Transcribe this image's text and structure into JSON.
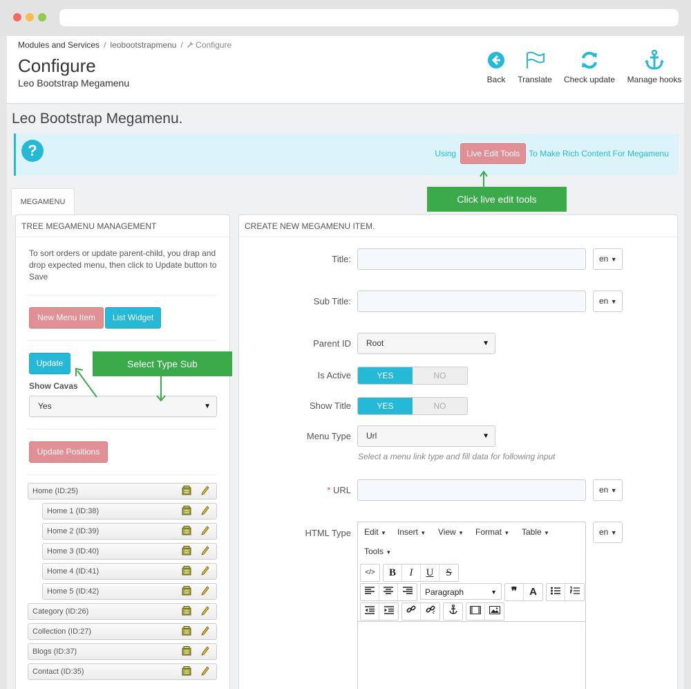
{
  "breadcrumb": {
    "item1": "Modules and Services",
    "item2": "leobootstrapmenu",
    "item3": "Configure",
    "separator": "/"
  },
  "header": {
    "title": "Configure",
    "subtitle": "Leo Bootstrap Megamenu"
  },
  "toolbar": {
    "back": "Back",
    "translate": "Translate",
    "check_update": "Check update",
    "manage_hooks": "Manage hooks"
  },
  "module_title": "Leo Bootstrap Megamenu.",
  "info": {
    "prefix": "Using",
    "button": "Live Edit Tools",
    "suffix": "To Make Rich Content For Megamenu"
  },
  "annotations": {
    "live_edit": "Click live edit tools",
    "select_type": "Select Type Sub"
  },
  "tab": "MEGAMENU",
  "left_panel": {
    "title": "TREE MEGAMENU MANAGEMENT",
    "help": "To sort orders or update parent-child, you drap and drop expected menu, then click to Update button to Save",
    "new_item": "New Menu Item",
    "list_widget": "List Widget",
    "update": "Update",
    "show_cavas_label": "Show Cavas",
    "show_cavas_value": "Yes",
    "update_positions": "Update Positions",
    "tree": [
      {
        "label": "Home (ID:25)",
        "level": 0
      },
      {
        "label": "Home 1 (ID:38)",
        "level": 1
      },
      {
        "label": "Home 2 (ID:39)",
        "level": 1
      },
      {
        "label": "Home 3 (ID:40)",
        "level": 1
      },
      {
        "label": "Home 4 (ID:41)",
        "level": 1
      },
      {
        "label": "Home 5 (ID:42)",
        "level": 1
      },
      {
        "label": "Category (ID:26)",
        "level": 0
      },
      {
        "label": "Collection (ID:27)",
        "level": 0
      },
      {
        "label": "Blogs (ID:37)",
        "level": 0
      },
      {
        "label": "Contact (ID:35)",
        "level": 0
      }
    ]
  },
  "form": {
    "title": "CREATE NEW MEGAMENU ITEM.",
    "title_label": "Title:",
    "subtitle_label": "Sub Title:",
    "parent_label": "Parent ID",
    "parent_value": "Root",
    "active_label": "Is Active",
    "show_title_label": "Show Title",
    "yes": "YES",
    "no": "NO",
    "menu_type_label": "Menu Type",
    "menu_type_value": "Url",
    "menu_type_hint": "Select a menu link type and fill data for following input",
    "url_label": "URL",
    "required_mark": "*",
    "html_type_label": "HTML Type",
    "lang": "en"
  },
  "editor": {
    "menus": [
      "Edit",
      "Insert",
      "View",
      "Format",
      "Table",
      "Tools"
    ],
    "format_value": "Paragraph"
  },
  "colors": {
    "accent": "#25b9d7",
    "pink": "#e08f95",
    "annotation": "#3aaa4b"
  }
}
